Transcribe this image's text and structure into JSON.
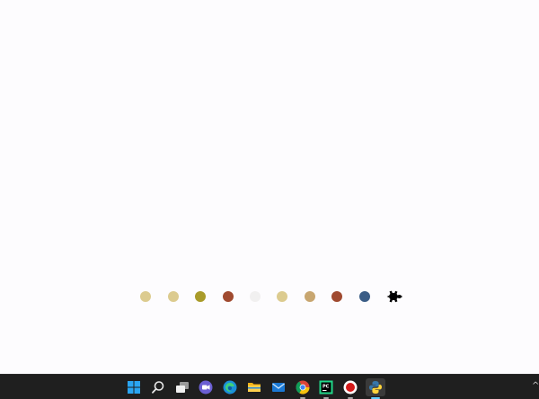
{
  "canvas": {
    "background": "#fdfcfe",
    "dots": [
      {
        "color": "#dccb8f"
      },
      {
        "color": "#dccb8f"
      },
      {
        "color": "#a99b2a"
      },
      {
        "color": "#a04a30"
      },
      {
        "color": "#f1f0f0"
      },
      {
        "color": "#dccb8f"
      },
      {
        "color": "#c8a670"
      },
      {
        "color": "#a04a30"
      },
      {
        "color": "#3b5d86"
      }
    ],
    "turtle": {
      "icon": "turtle-cursor-icon",
      "color": "#000000"
    }
  },
  "taskbar": {
    "background": "#1f1f1f",
    "icons": [
      {
        "name": "windows-start-icon"
      },
      {
        "name": "search-icon"
      },
      {
        "name": "task-view-icon"
      },
      {
        "name": "teams-chat-icon"
      },
      {
        "name": "edge-browser-icon"
      },
      {
        "name": "file-explorer-icon"
      },
      {
        "name": "mail-icon"
      },
      {
        "name": "chrome-icon"
      },
      {
        "name": "pycharm-icon"
      },
      {
        "name": "screen-recorder-icon"
      },
      {
        "name": "python-turtle-icon"
      }
    ],
    "tray_chevron": "^"
  }
}
